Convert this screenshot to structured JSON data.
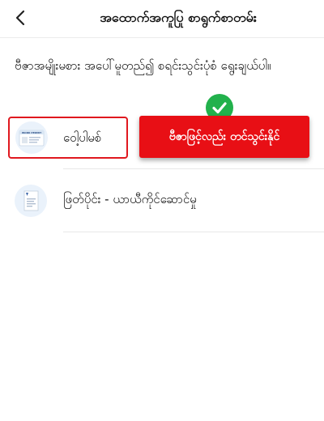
{
  "header": {
    "back_icon": "chevron-left-icon",
    "title": "အထောက်အကူပြု စာရွက်စာတမ်း"
  },
  "instruction": "ဗီဇာအမျိုးမစား အပေါ်မူတည်၍ စရင်းသွင်းပုံစံ ရွေးချယ်ပါ။",
  "options": [
    {
      "label": "ဝေါ့ပါမစ်",
      "icon": "work-permit-card-icon",
      "thumb_text": "WORK PERMIT",
      "selected": true
    },
    {
      "label": "ဖြတ်ပိုင်း - ယာယီကိုင်ဆောင်မှု",
      "icon": "document-receipt-icon",
      "selected": false
    }
  ],
  "callout": {
    "text": "ဗီဇာဖြင့်လည်း တင်သွင်းနိုင်",
    "badge_icon": "checkmark-icon",
    "color": "#e80f15",
    "badge_color": "#22b14c"
  },
  "colors": {
    "selected_border": "#e0181f",
    "divider": "#e8e8e8"
  }
}
